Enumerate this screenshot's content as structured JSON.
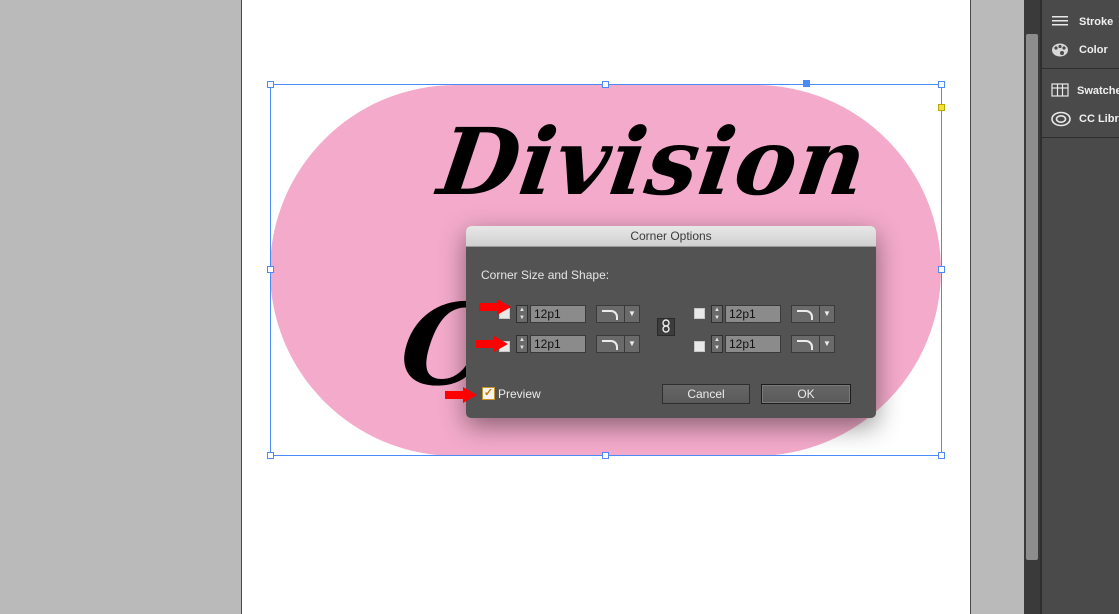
{
  "document": {
    "headline_line1": "Division",
    "headline_line2": "C"
  },
  "dock": {
    "group1": [
      {
        "label": "Stroke",
        "icon": "stroke-icon"
      },
      {
        "label": "Color",
        "icon": "color-palette-icon"
      }
    ],
    "group2": [
      {
        "label": "Swatches",
        "icon": "swatches-icon"
      },
      {
        "label": "CC Libraries",
        "icon": "cc-libraries-icon"
      }
    ]
  },
  "dialog": {
    "title": "Corner Options",
    "section_label": "Corner Size and Shape:",
    "corners": {
      "top_left": "12p1",
      "bottom_left": "12p1",
      "top_right": "12p1",
      "bottom_right": "12p1"
    },
    "link_icon": "chain-link-icon",
    "preview_label": "Preview",
    "preview_checked": true,
    "check_mark": "✓",
    "cancel_label": "Cancel",
    "ok_label": "OK"
  },
  "colors": {
    "pink": "#f4abcb",
    "selection_blue": "#4c8bf5",
    "annotation_red": "#ff0000",
    "dialog_bg": "#535353"
  }
}
